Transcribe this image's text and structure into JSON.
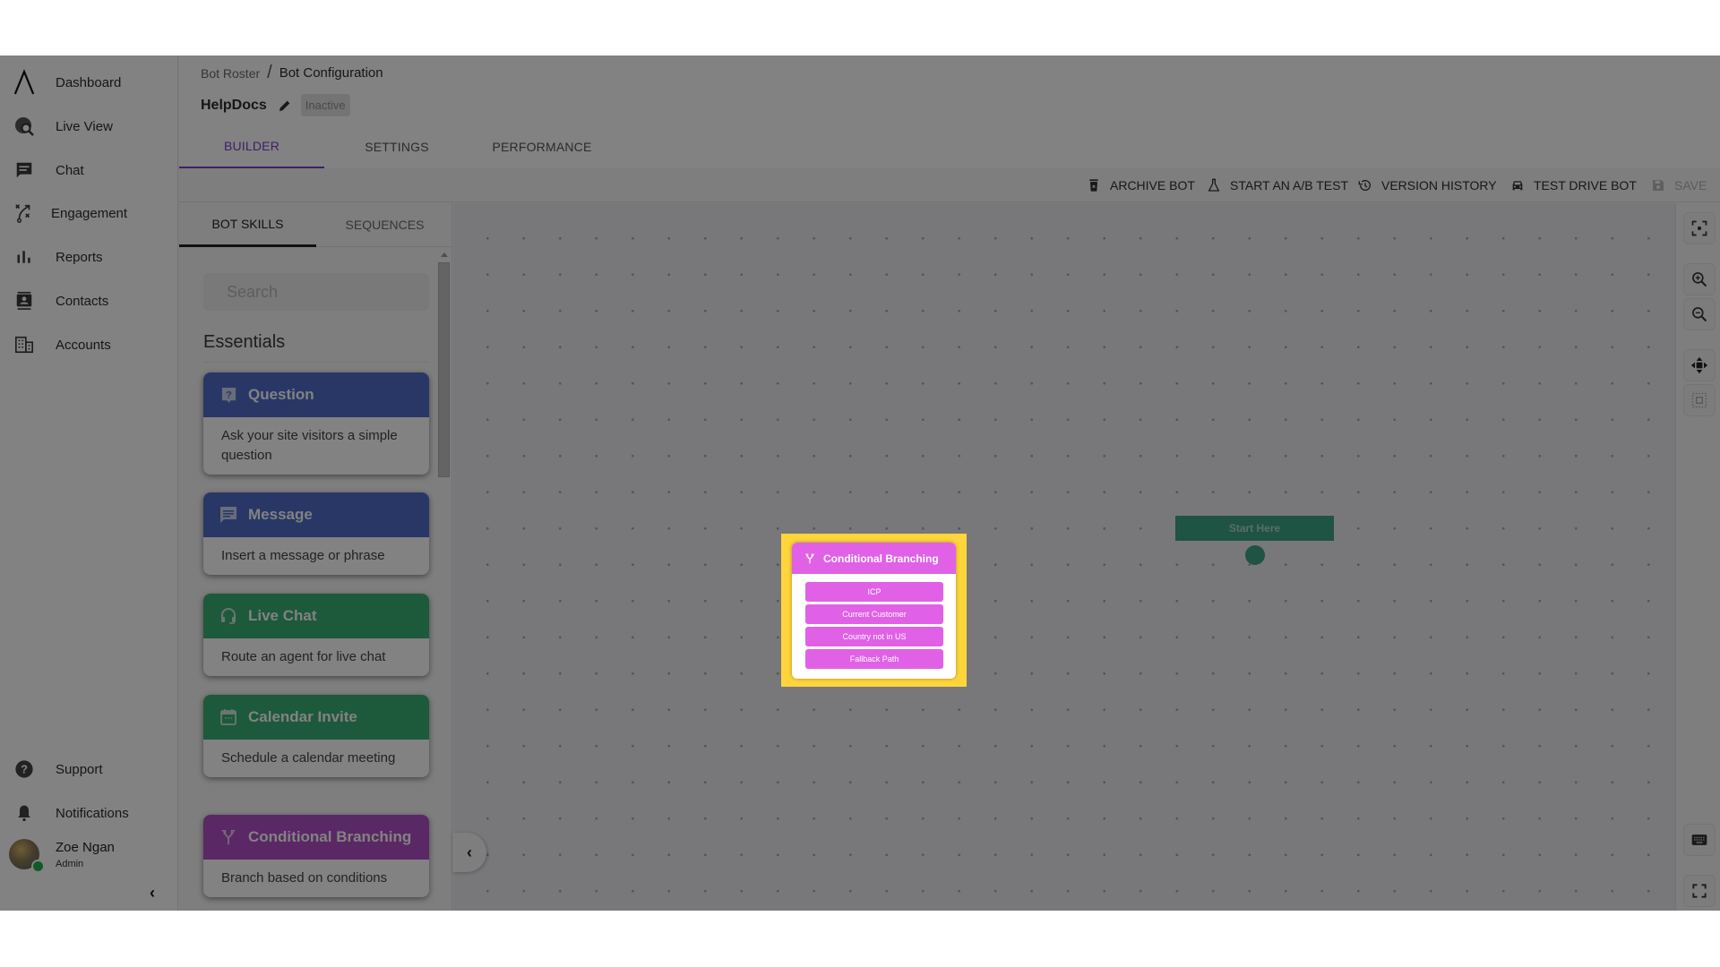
{
  "sidebar": {
    "items": [
      {
        "label": "Dashboard",
        "icon": "logo-icon"
      },
      {
        "label": "Live View",
        "icon": "live-view-icon"
      },
      {
        "label": "Chat",
        "icon": "chat-icon"
      },
      {
        "label": "Engagement",
        "icon": "engagement-icon"
      },
      {
        "label": "Reports",
        "icon": "reports-icon"
      },
      {
        "label": "Contacts",
        "icon": "contacts-icon"
      },
      {
        "label": "Accounts",
        "icon": "accounts-icon"
      }
    ],
    "bottom_items": [
      {
        "label": "Support",
        "icon": "help-icon"
      },
      {
        "label": "Notifications",
        "icon": "bell-icon"
      }
    ],
    "user": {
      "name": "Zoe Ngan",
      "role": "Admin",
      "status_color": "#1fb34a"
    },
    "collapse_icon": "chevron-left-icon"
  },
  "header": {
    "breadcrumb": [
      {
        "label": "Bot Roster"
      },
      {
        "label": "Bot Configuration"
      }
    ],
    "breadcrumb_separator": "/",
    "bot_name": "HelpDocs",
    "status_badge": "Inactive",
    "tabs": [
      {
        "label": "BUILDER",
        "active": true
      },
      {
        "label": "SETTINGS",
        "active": false
      },
      {
        "label": "PERFORMANCE",
        "active": false
      }
    ],
    "accent_color": "#7a3ec8"
  },
  "toolbar": {
    "archive": "ARCHIVE BOT",
    "ab_test": "START AN A/B TEST",
    "version_history": "VERSION HISTORY",
    "test_drive": "TEST DRIVE BOT",
    "save": "SAVE",
    "save_disabled": true
  },
  "panel": {
    "tabs": [
      {
        "label": "BOT SKILLS",
        "active": true
      },
      {
        "label": "SEQUENCES",
        "active": false
      }
    ],
    "search_placeholder": "Search",
    "section_title": "Essentials",
    "skills": [
      {
        "title": "Question",
        "description": "Ask your site visitors a simple question",
        "color": "#4f6cc8",
        "icon": "question-icon"
      },
      {
        "title": "Message",
        "description": "Insert a message or phrase",
        "color": "#4f6cc8",
        "icon": "message-icon"
      },
      {
        "title": "Live Chat",
        "description": "Route an agent for live chat",
        "color": "#3aae74",
        "icon": "headset-icon"
      },
      {
        "title": "Calendar Invite",
        "description": "Schedule a calendar meeting",
        "color": "#3aae74",
        "icon": "calendar-icon"
      },
      {
        "title": "Conditional Branching",
        "description": "Branch based on conditions",
        "color": "#b150c4",
        "icon": "branch-icon"
      }
    ]
  },
  "canvas": {
    "start_node": {
      "label": "Start Here",
      "color": "#3ea386"
    },
    "branch_node": {
      "title": "Conditional Branching",
      "color": "#e061e6",
      "highlight_color": "#ffd53b",
      "options": [
        "ICP",
        "Current Customer",
        "Country not in US",
        "Fallback Path"
      ]
    }
  },
  "rail": {
    "buttons": [
      "fit-view-icon",
      "zoom-in-icon",
      "zoom-out-icon",
      "pan-icon",
      "select-area-icon",
      "keyboard-icon",
      "fullscreen-icon"
    ]
  }
}
